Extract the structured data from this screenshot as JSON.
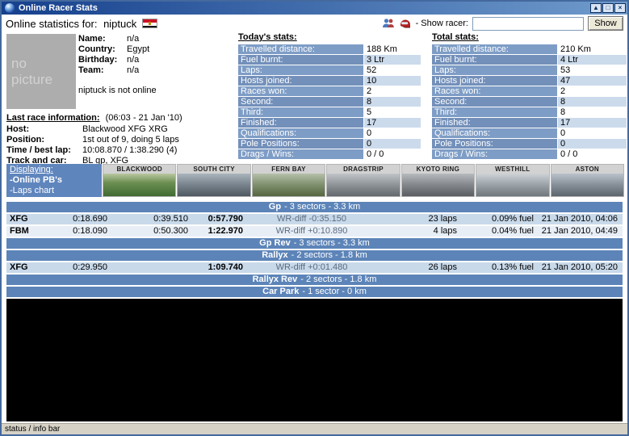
{
  "window": {
    "title": "Online Racer Stats",
    "buttons": {
      "shade": "▲",
      "maximize": "□",
      "close": "×"
    }
  },
  "header": {
    "title_prefix": "Online statistics for:",
    "racer_name": "niptuck",
    "show_racer_label": "- Show racer:",
    "search_value": "",
    "show_button_label": "Show"
  },
  "profile": {
    "no_picture": "no picture",
    "fields": [
      {
        "label": "Name:",
        "value": "n/a"
      },
      {
        "label": "Country:",
        "value": "Egypt"
      },
      {
        "label": "Birthday:",
        "value": "n/a"
      },
      {
        "label": "Team:",
        "value": "n/a"
      }
    ],
    "online_status": "niptuck is not online"
  },
  "last_race": {
    "title": "Last race information:",
    "timestamp": "(06:03 - 21 Jan '10)",
    "fields": [
      {
        "label": "Host:",
        "value": "Blackwood XFG XRG"
      },
      {
        "label": "Position:",
        "value": "1st out of 9, doing 5 laps"
      },
      {
        "label": "Time / best lap:",
        "value": "10:08.870 / 1:38.290 (4)"
      },
      {
        "label": "Track and car:",
        "value": "BL gp, XFG"
      }
    ]
  },
  "todays_stats": {
    "title": "Today's stats:",
    "rows": [
      {
        "label": "Travelled distance:",
        "value": "188 Km"
      },
      {
        "label": "Fuel burnt:",
        "value": "3 Ltr"
      },
      {
        "label": "Laps:",
        "value": "52"
      },
      {
        "label": "Hosts joined:",
        "value": "10"
      },
      {
        "label": "Races won:",
        "value": "2"
      },
      {
        "label": "Second:",
        "value": "8"
      },
      {
        "label": "Third:",
        "value": "5"
      },
      {
        "label": "Finished:",
        "value": "17"
      },
      {
        "label": "Qualifications:",
        "value": "0"
      },
      {
        "label": "Pole Positions:",
        "value": "0"
      },
      {
        "label": "Drags / Wins:",
        "value": "0 / 0"
      }
    ]
  },
  "total_stats": {
    "title": "Total stats:",
    "rows": [
      {
        "label": "Travelled distance:",
        "value": "210 Km"
      },
      {
        "label": "Fuel burnt:",
        "value": "4 Ltr"
      },
      {
        "label": "Laps:",
        "value": "53"
      },
      {
        "label": "Hosts joined:",
        "value": "47"
      },
      {
        "label": "Races won:",
        "value": "2"
      },
      {
        "label": "Second:",
        "value": "8"
      },
      {
        "label": "Third:",
        "value": "8"
      },
      {
        "label": "Finished:",
        "value": "17"
      },
      {
        "label": "Qualifications:",
        "value": "0"
      },
      {
        "label": "Pole Positions:",
        "value": "0"
      },
      {
        "label": "Drags / Wins:",
        "value": "0 / 0"
      }
    ]
  },
  "displaying": {
    "title": "Displaying:",
    "items": [
      "-Online PB's",
      "-Laps chart"
    ]
  },
  "tracks": [
    "BLACKWOOD",
    "SOUTH CITY",
    "FERN BAY",
    "DRAGSTRIP",
    "KYOTO RING",
    "WESTHILL",
    "ASTON"
  ],
  "pb_table": {
    "sections": [
      {
        "name": "Gp",
        "info": "- 3 sectors - 3.3 km",
        "rows": [
          {
            "car": "XFG",
            "split1": "0:18.690",
            "split2": "0:39.510",
            "total": "0:57.790",
            "wr_diff": "WR-diff -0:35.150",
            "laps": "23 laps",
            "fuel": "0.09% fuel",
            "date": "21 Jan 2010, 04:06"
          },
          {
            "car": "FBM",
            "split1": "0:18.090",
            "split2": "0:50.300",
            "total": "1:22.970",
            "wr_diff": "WR-diff +0:10.890",
            "laps": "4 laps",
            "fuel": "0.04% fuel",
            "date": "21 Jan 2010, 04:49"
          }
        ]
      },
      {
        "name": "Gp Rev",
        "info": "- 3 sectors - 3.3 km"
      },
      {
        "name": "Rallyx",
        "info": "- 2 sectors - 1.8 km",
        "rows": [
          {
            "car": "XFG",
            "split1": "0:29.950",
            "split2": "",
            "total": "1:09.740",
            "wr_diff": "WR-diff +0:01.480",
            "laps": "26 laps",
            "fuel": "0.13% fuel",
            "date": "21 Jan 2010, 05:20"
          }
        ]
      },
      {
        "name": "Rallyx Rev",
        "info": "- 2 sectors - 1.8 km"
      },
      {
        "name": "Car Park",
        "info": "- 1 sector - 0 km"
      }
    ]
  },
  "status_bar": "status / info bar"
}
